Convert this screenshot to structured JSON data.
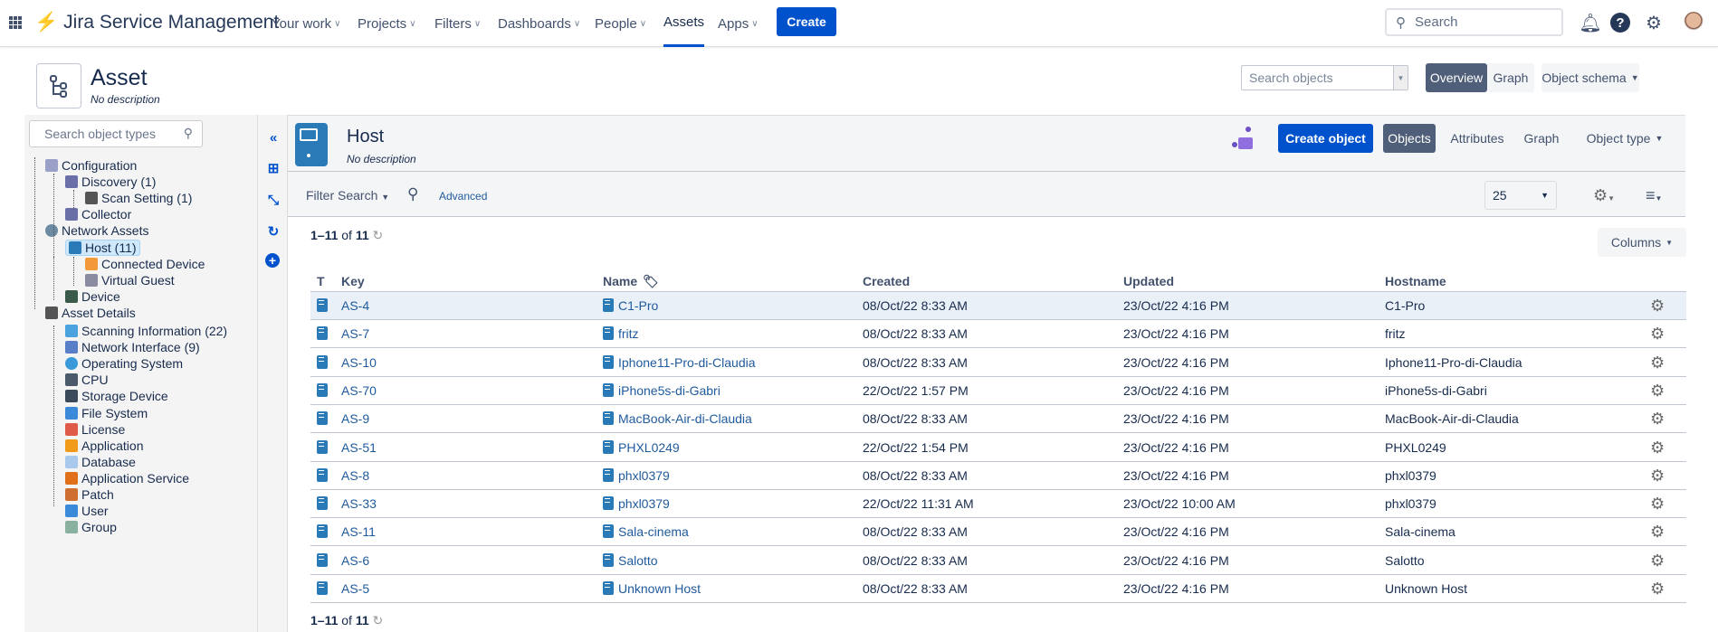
{
  "topnav": {
    "product": "Jira Service Management",
    "items": [
      {
        "label": "Your work",
        "chevron": true
      },
      {
        "label": "Projects",
        "chevron": true
      },
      {
        "label": "Filters",
        "chevron": true
      },
      {
        "label": "Dashboards",
        "chevron": true
      },
      {
        "label": "People",
        "chevron": true
      },
      {
        "label": "Assets",
        "chevron": false,
        "active": true
      },
      {
        "label": "Apps",
        "chevron": true
      }
    ],
    "create": "Create",
    "search_placeholder": "Search"
  },
  "schema": {
    "title": "Asset",
    "description": "No description",
    "search_placeholder": "Search objects",
    "overview": "Overview",
    "graph": "Graph",
    "object_schema": "Object schema"
  },
  "sidebar": {
    "search_placeholder": "Search object types",
    "tree": [
      {
        "label": "Configuration",
        "level": 0,
        "icon": "configuration-icon"
      },
      {
        "label": "Discovery (1)",
        "level": 1,
        "icon": "discovery-icon"
      },
      {
        "label": "Scan Setting (1)",
        "level": 2,
        "icon": "gear-icon"
      },
      {
        "label": "Collector",
        "level": 1,
        "icon": "collector-icon"
      },
      {
        "label": "Network Assets",
        "level": 0,
        "icon": "database-circle-icon"
      },
      {
        "label": "Host (11)",
        "level": 1,
        "icon": "host-icon",
        "selected": true
      },
      {
        "label": "Connected Device",
        "level": 2,
        "icon": "connected-device-icon"
      },
      {
        "label": "Virtual Guest",
        "level": 2,
        "icon": "virtual-guest-icon"
      },
      {
        "label": "Device",
        "level": 1,
        "icon": "device-icon"
      },
      {
        "label": "Asset Details",
        "level": 0,
        "icon": "asset-details-icon"
      },
      {
        "label": "Scanning Information (22)",
        "level": 1,
        "icon": "scanning-icon"
      },
      {
        "label": "Network Interface (9)",
        "level": 1,
        "icon": "network-interface-icon"
      },
      {
        "label": "Operating System",
        "level": 1,
        "icon": "os-icon"
      },
      {
        "label": "CPU",
        "level": 1,
        "icon": "cpu-icon"
      },
      {
        "label": "Storage Device",
        "level": 1,
        "icon": "storage-icon"
      },
      {
        "label": "File System",
        "level": 1,
        "icon": "folder-icon"
      },
      {
        "label": "License",
        "level": 1,
        "icon": "license-icon"
      },
      {
        "label": "Application",
        "level": 1,
        "icon": "application-icon"
      },
      {
        "label": "Database",
        "level": 1,
        "icon": "database-icon"
      },
      {
        "label": "Application Service",
        "level": 1,
        "icon": "application-service-icon"
      },
      {
        "label": "Patch",
        "level": 1,
        "icon": "patch-icon"
      },
      {
        "label": "User",
        "level": 1,
        "icon": "user-icon"
      },
      {
        "label": "Group",
        "level": 1,
        "icon": "group-icon"
      }
    ]
  },
  "objecttype": {
    "title": "Host",
    "description": "No description",
    "create_object": "Create object",
    "tabs": [
      "Objects",
      "Attributes",
      "Graph",
      "Object type"
    ]
  },
  "filter": {
    "filter_search": "Filter Search",
    "advanced": "Advanced",
    "page_size": "25"
  },
  "pagination": {
    "range": "1–11",
    "of": "of",
    "total": "11"
  },
  "columns_button": "Columns",
  "table": {
    "headers": [
      "T",
      "Key",
      "Name",
      "Created",
      "Updated",
      "Hostname"
    ],
    "rows": [
      {
        "key": "AS-4",
        "name": "C1-Pro",
        "created": "08/Oct/22 8:33 AM",
        "updated": "23/Oct/22 4:16 PM",
        "hostname": "C1-Pro"
      },
      {
        "key": "AS-7",
        "name": "fritz",
        "created": "08/Oct/22 8:33 AM",
        "updated": "23/Oct/22 4:16 PM",
        "hostname": "fritz"
      },
      {
        "key": "AS-10",
        "name": "Iphone11-Pro-di-Claudia",
        "created": "08/Oct/22 8:33 AM",
        "updated": "23/Oct/22 4:16 PM",
        "hostname": "Iphone11-Pro-di-Claudia"
      },
      {
        "key": "AS-70",
        "name": "iPhone5s-di-Gabri",
        "created": "22/Oct/22 1:57 PM",
        "updated": "23/Oct/22 4:16 PM",
        "hostname": "iPhone5s-di-Gabri"
      },
      {
        "key": "AS-9",
        "name": "MacBook-Air-di-Claudia",
        "created": "08/Oct/22 8:33 AM",
        "updated": "23/Oct/22 4:16 PM",
        "hostname": "MacBook-Air-di-Claudia"
      },
      {
        "key": "AS-51",
        "name": "PHXL0249",
        "created": "22/Oct/22 1:54 PM",
        "updated": "23/Oct/22 4:16 PM",
        "hostname": "PHXL0249"
      },
      {
        "key": "AS-8",
        "name": "phxl0379",
        "created": "08/Oct/22 8:33 AM",
        "updated": "23/Oct/22 4:16 PM",
        "hostname": "phxl0379"
      },
      {
        "key": "AS-33",
        "name": "phxl0379",
        "created": "22/Oct/22 11:31 AM",
        "updated": "23/Oct/22 10:00 AM",
        "hostname": "phxl0379"
      },
      {
        "key": "AS-11",
        "name": "Sala-cinema",
        "created": "08/Oct/22 8:33 AM",
        "updated": "23/Oct/22 4:16 PM",
        "hostname": "Sala-cinema"
      },
      {
        "key": "AS-6",
        "name": "Salotto",
        "created": "08/Oct/22 8:33 AM",
        "updated": "23/Oct/22 4:16 PM",
        "hostname": "Salotto"
      },
      {
        "key": "AS-5",
        "name": "Unknown Host",
        "created": "08/Oct/22 8:33 AM",
        "updated": "23/Oct/22 4:16 PM",
        "hostname": "Unknown Host"
      }
    ]
  }
}
